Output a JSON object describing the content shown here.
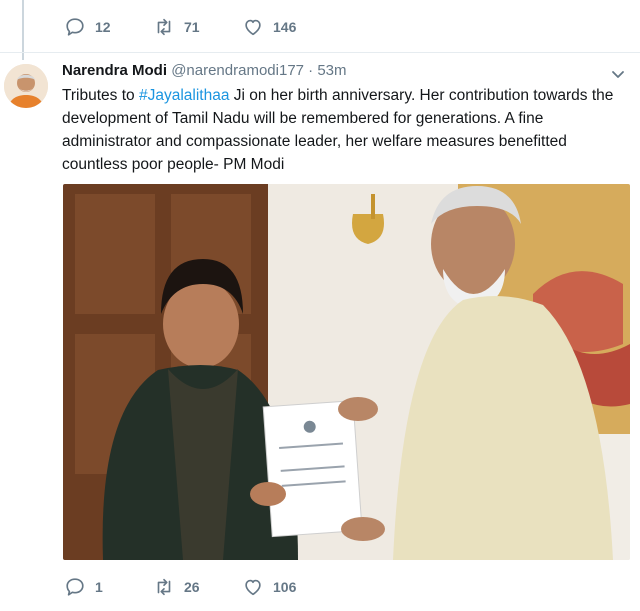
{
  "top_actions": {
    "replies": "12",
    "retweets": "71",
    "likes": "146"
  },
  "tweet": {
    "author_name": "Narendra Modi",
    "author_handle": "@narendramodi177",
    "separator": "·",
    "time": "53m",
    "text_before": "Tributes to ",
    "hashtag": "#Jayalalithaa",
    "text_after": " Ji on her birth anniversary. Her contribution towards the development of Tamil Nadu will be remembered for generations. A fine administrator and compassionate leader, her welfare measures benefitted countless poor people- PM Modi"
  },
  "bottom_actions": {
    "replies": "1",
    "retweets": "26",
    "likes": "106"
  },
  "icons": {
    "reply": "reply-icon",
    "retweet": "retweet-icon",
    "like": "heart-icon",
    "caret": "chevron-down-icon"
  },
  "colors": {
    "meta_gray": "#657786",
    "link_blue": "#1b95e0",
    "text": "#14171a"
  }
}
